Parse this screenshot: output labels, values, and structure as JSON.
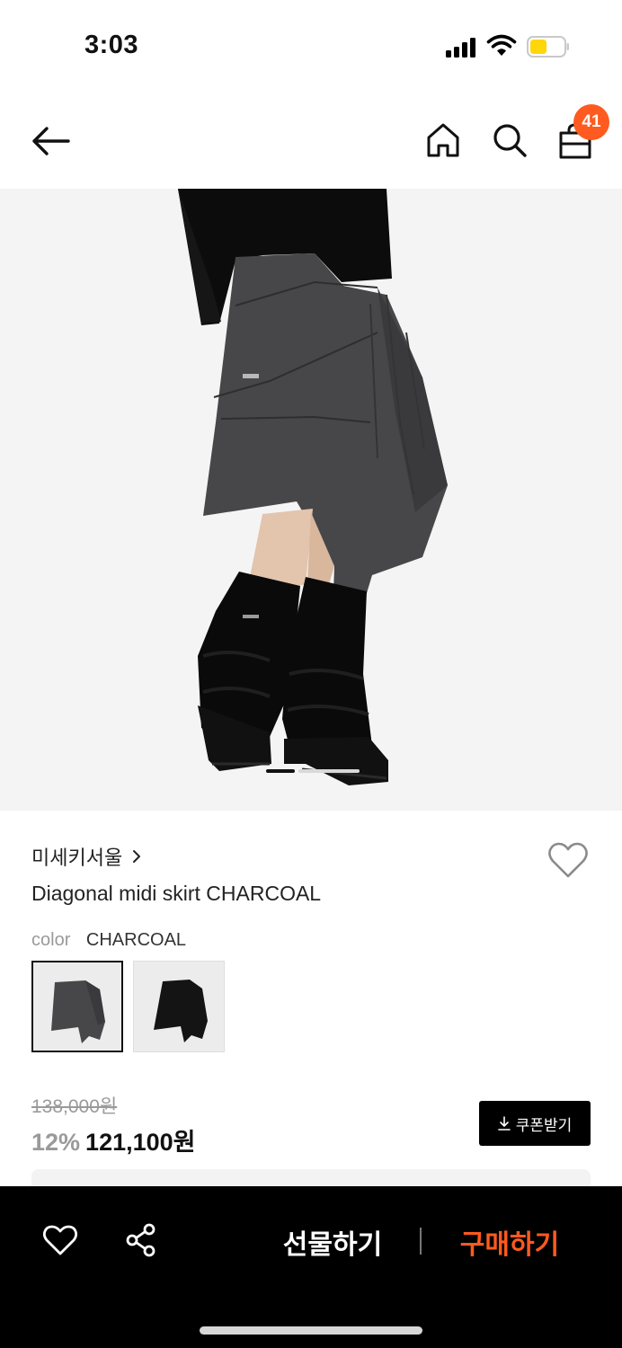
{
  "status_bar": {
    "time": "3:03"
  },
  "header": {
    "cart_count": "41",
    "icons": [
      "back-arrow-icon",
      "home-icon",
      "search-icon",
      "shopping-bag-icon"
    ]
  },
  "product": {
    "brand": "미세키서울",
    "name": "Diagonal midi skirt CHARCOAL",
    "color_label": "color",
    "color_value": "CHARCOAL",
    "image_index": 1,
    "original_price": "138,000원",
    "discount": "12%",
    "price": "121,100원",
    "coupon_label": "쿠폰받기"
  },
  "bottom_bar": {
    "gift_label": "선물하기",
    "buy_label": "구매하기"
  },
  "colors": {
    "accent": "#ff5a1f",
    "bar_bg": "#000000"
  }
}
